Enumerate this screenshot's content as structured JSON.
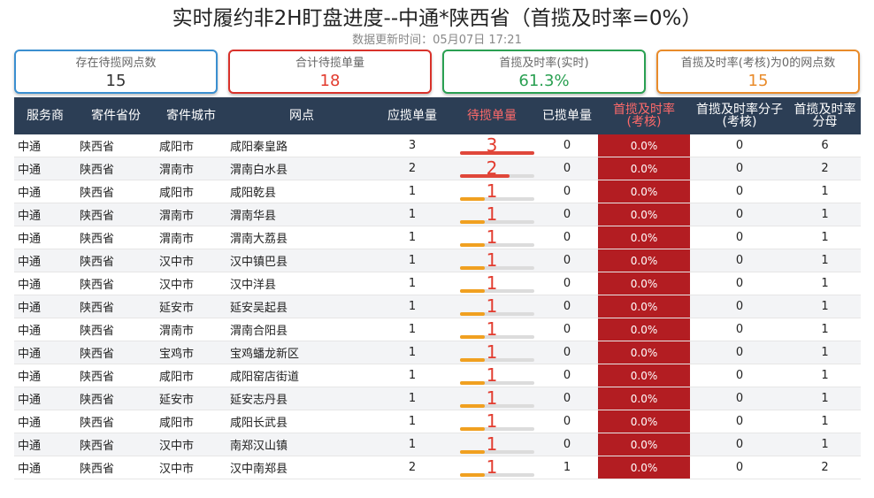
{
  "header": {
    "title": "实时履约非2H盯盘进度--中通*陕西省（首揽及时率=0%）",
    "subtitle": "数据更新时间：05月07日 17:21"
  },
  "cards": [
    {
      "label": "存在待揽网点数",
      "value": "15"
    },
    {
      "label": "合计待揽单量",
      "value": "18"
    },
    {
      "label": "首揽及时率(实时)",
      "value": "61.3%"
    },
    {
      "label": "首揽及时率(考核)为0的网点数",
      "value": "15"
    }
  ],
  "table": {
    "headers": [
      "服务商",
      "寄件省份",
      "寄件城市",
      "网点",
      "应揽单量",
      "待揽单量",
      "已揽单量",
      "首揽及时率\n(考核)",
      "首揽及时率分子\n(考核)",
      "首揽及时率\n分母"
    ],
    "rows": [
      {
        "provider": "中通",
        "province": "陕西省",
        "city": "咸阳市",
        "site": "咸阳秦皇路",
        "due": "3",
        "pending": "3",
        "pending_frac": 1.0,
        "done": "0",
        "rate": "0.0%",
        "num": "0",
        "den": "6"
      },
      {
        "provider": "中通",
        "province": "陕西省",
        "city": "渭南市",
        "site": "渭南白水县",
        "due": "2",
        "pending": "2",
        "pending_frac": 0.67,
        "done": "0",
        "rate": "0.0%",
        "num": "0",
        "den": "2"
      },
      {
        "provider": "中通",
        "province": "陕西省",
        "city": "咸阳市",
        "site": "咸阳乾县",
        "due": "1",
        "pending": "1",
        "pending_frac": 0.33,
        "done": "0",
        "rate": "0.0%",
        "num": "0",
        "den": "1"
      },
      {
        "provider": "中通",
        "province": "陕西省",
        "city": "渭南市",
        "site": "渭南华县",
        "due": "1",
        "pending": "1",
        "pending_frac": 0.33,
        "done": "0",
        "rate": "0.0%",
        "num": "0",
        "den": "1"
      },
      {
        "provider": "中通",
        "province": "陕西省",
        "city": "渭南市",
        "site": "渭南大荔县",
        "due": "1",
        "pending": "1",
        "pending_frac": 0.33,
        "done": "0",
        "rate": "0.0%",
        "num": "0",
        "den": "1"
      },
      {
        "provider": "中通",
        "province": "陕西省",
        "city": "汉中市",
        "site": "汉中镇巴县",
        "due": "1",
        "pending": "1",
        "pending_frac": 0.33,
        "done": "0",
        "rate": "0.0%",
        "num": "0",
        "den": "1"
      },
      {
        "provider": "中通",
        "province": "陕西省",
        "city": "汉中市",
        "site": "汉中洋县",
        "due": "1",
        "pending": "1",
        "pending_frac": 0.33,
        "done": "0",
        "rate": "0.0%",
        "num": "0",
        "den": "1"
      },
      {
        "provider": "中通",
        "province": "陕西省",
        "city": "延安市",
        "site": "延安吴起县",
        "due": "1",
        "pending": "1",
        "pending_frac": 0.33,
        "done": "0",
        "rate": "0.0%",
        "num": "0",
        "den": "1"
      },
      {
        "provider": "中通",
        "province": "陕西省",
        "city": "渭南市",
        "site": "渭南合阳县",
        "due": "1",
        "pending": "1",
        "pending_frac": 0.33,
        "done": "0",
        "rate": "0.0%",
        "num": "0",
        "den": "1"
      },
      {
        "provider": "中通",
        "province": "陕西省",
        "city": "宝鸡市",
        "site": "宝鸡蟠龙新区",
        "due": "1",
        "pending": "1",
        "pending_frac": 0.33,
        "done": "0",
        "rate": "0.0%",
        "num": "0",
        "den": "1"
      },
      {
        "provider": "中通",
        "province": "陕西省",
        "city": "咸阳市",
        "site": "咸阳窑店街道",
        "due": "1",
        "pending": "1",
        "pending_frac": 0.33,
        "done": "0",
        "rate": "0.0%",
        "num": "0",
        "den": "1"
      },
      {
        "provider": "中通",
        "province": "陕西省",
        "city": "延安市",
        "site": "延安志丹县",
        "due": "1",
        "pending": "1",
        "pending_frac": 0.33,
        "done": "0",
        "rate": "0.0%",
        "num": "0",
        "den": "1"
      },
      {
        "provider": "中通",
        "province": "陕西省",
        "city": "咸阳市",
        "site": "咸阳长武县",
        "due": "1",
        "pending": "1",
        "pending_frac": 0.33,
        "done": "0",
        "rate": "0.0%",
        "num": "0",
        "den": "1"
      },
      {
        "provider": "中通",
        "province": "陕西省",
        "city": "汉中市",
        "site": "南郑汉山镇",
        "due": "1",
        "pending": "1",
        "pending_frac": 0.33,
        "done": "0",
        "rate": "0.0%",
        "num": "0",
        "den": "1"
      },
      {
        "provider": "中通",
        "province": "陕西省",
        "city": "汉中市",
        "site": "汉中南郑县",
        "due": "2",
        "pending": "1",
        "pending_frac": 0.33,
        "done": "1",
        "rate": "0.0%",
        "num": "0",
        "den": "2"
      }
    ]
  },
  "colors": {
    "bar_high": "#e0473a",
    "bar_low": "#f0a020",
    "rate_bg": "#b31d22",
    "header_bg": "#2c3e55"
  }
}
